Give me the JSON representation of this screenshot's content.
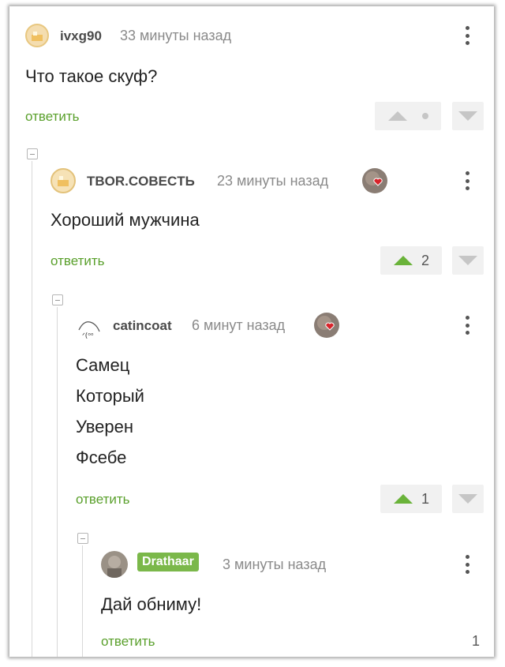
{
  "comments": [
    {
      "user": "ivxg90",
      "time": "33 минуты назад",
      "lines": [
        "Что такое скуф?"
      ],
      "reply": "ответить",
      "votes": ""
    },
    {
      "user": "TBOR.COBECTЬ",
      "time": "23 минуты назад",
      "lines": [
        "Хороший мужчина"
      ],
      "reply": "ответить",
      "votes": "2"
    },
    {
      "user": "catincoat",
      "time": "6 минут назад",
      "lines": [
        "Самец",
        "Который",
        "Уверен",
        "Фсебе"
      ],
      "reply": "ответить",
      "votes": "1"
    },
    {
      "user": "Drathaar",
      "time": "3 минуты назад",
      "lines": [
        "Дай обниму!"
      ],
      "reply": "ответить",
      "votes": "1"
    }
  ],
  "colors": {
    "accent": "#5aa02c",
    "badge": "#7bb84a",
    "vote_bg": "#f1f1f1"
  },
  "icons": [
    "collapse-icon",
    "upvote-icon",
    "downvote-icon",
    "more-icon",
    "heart-badge-icon"
  ]
}
